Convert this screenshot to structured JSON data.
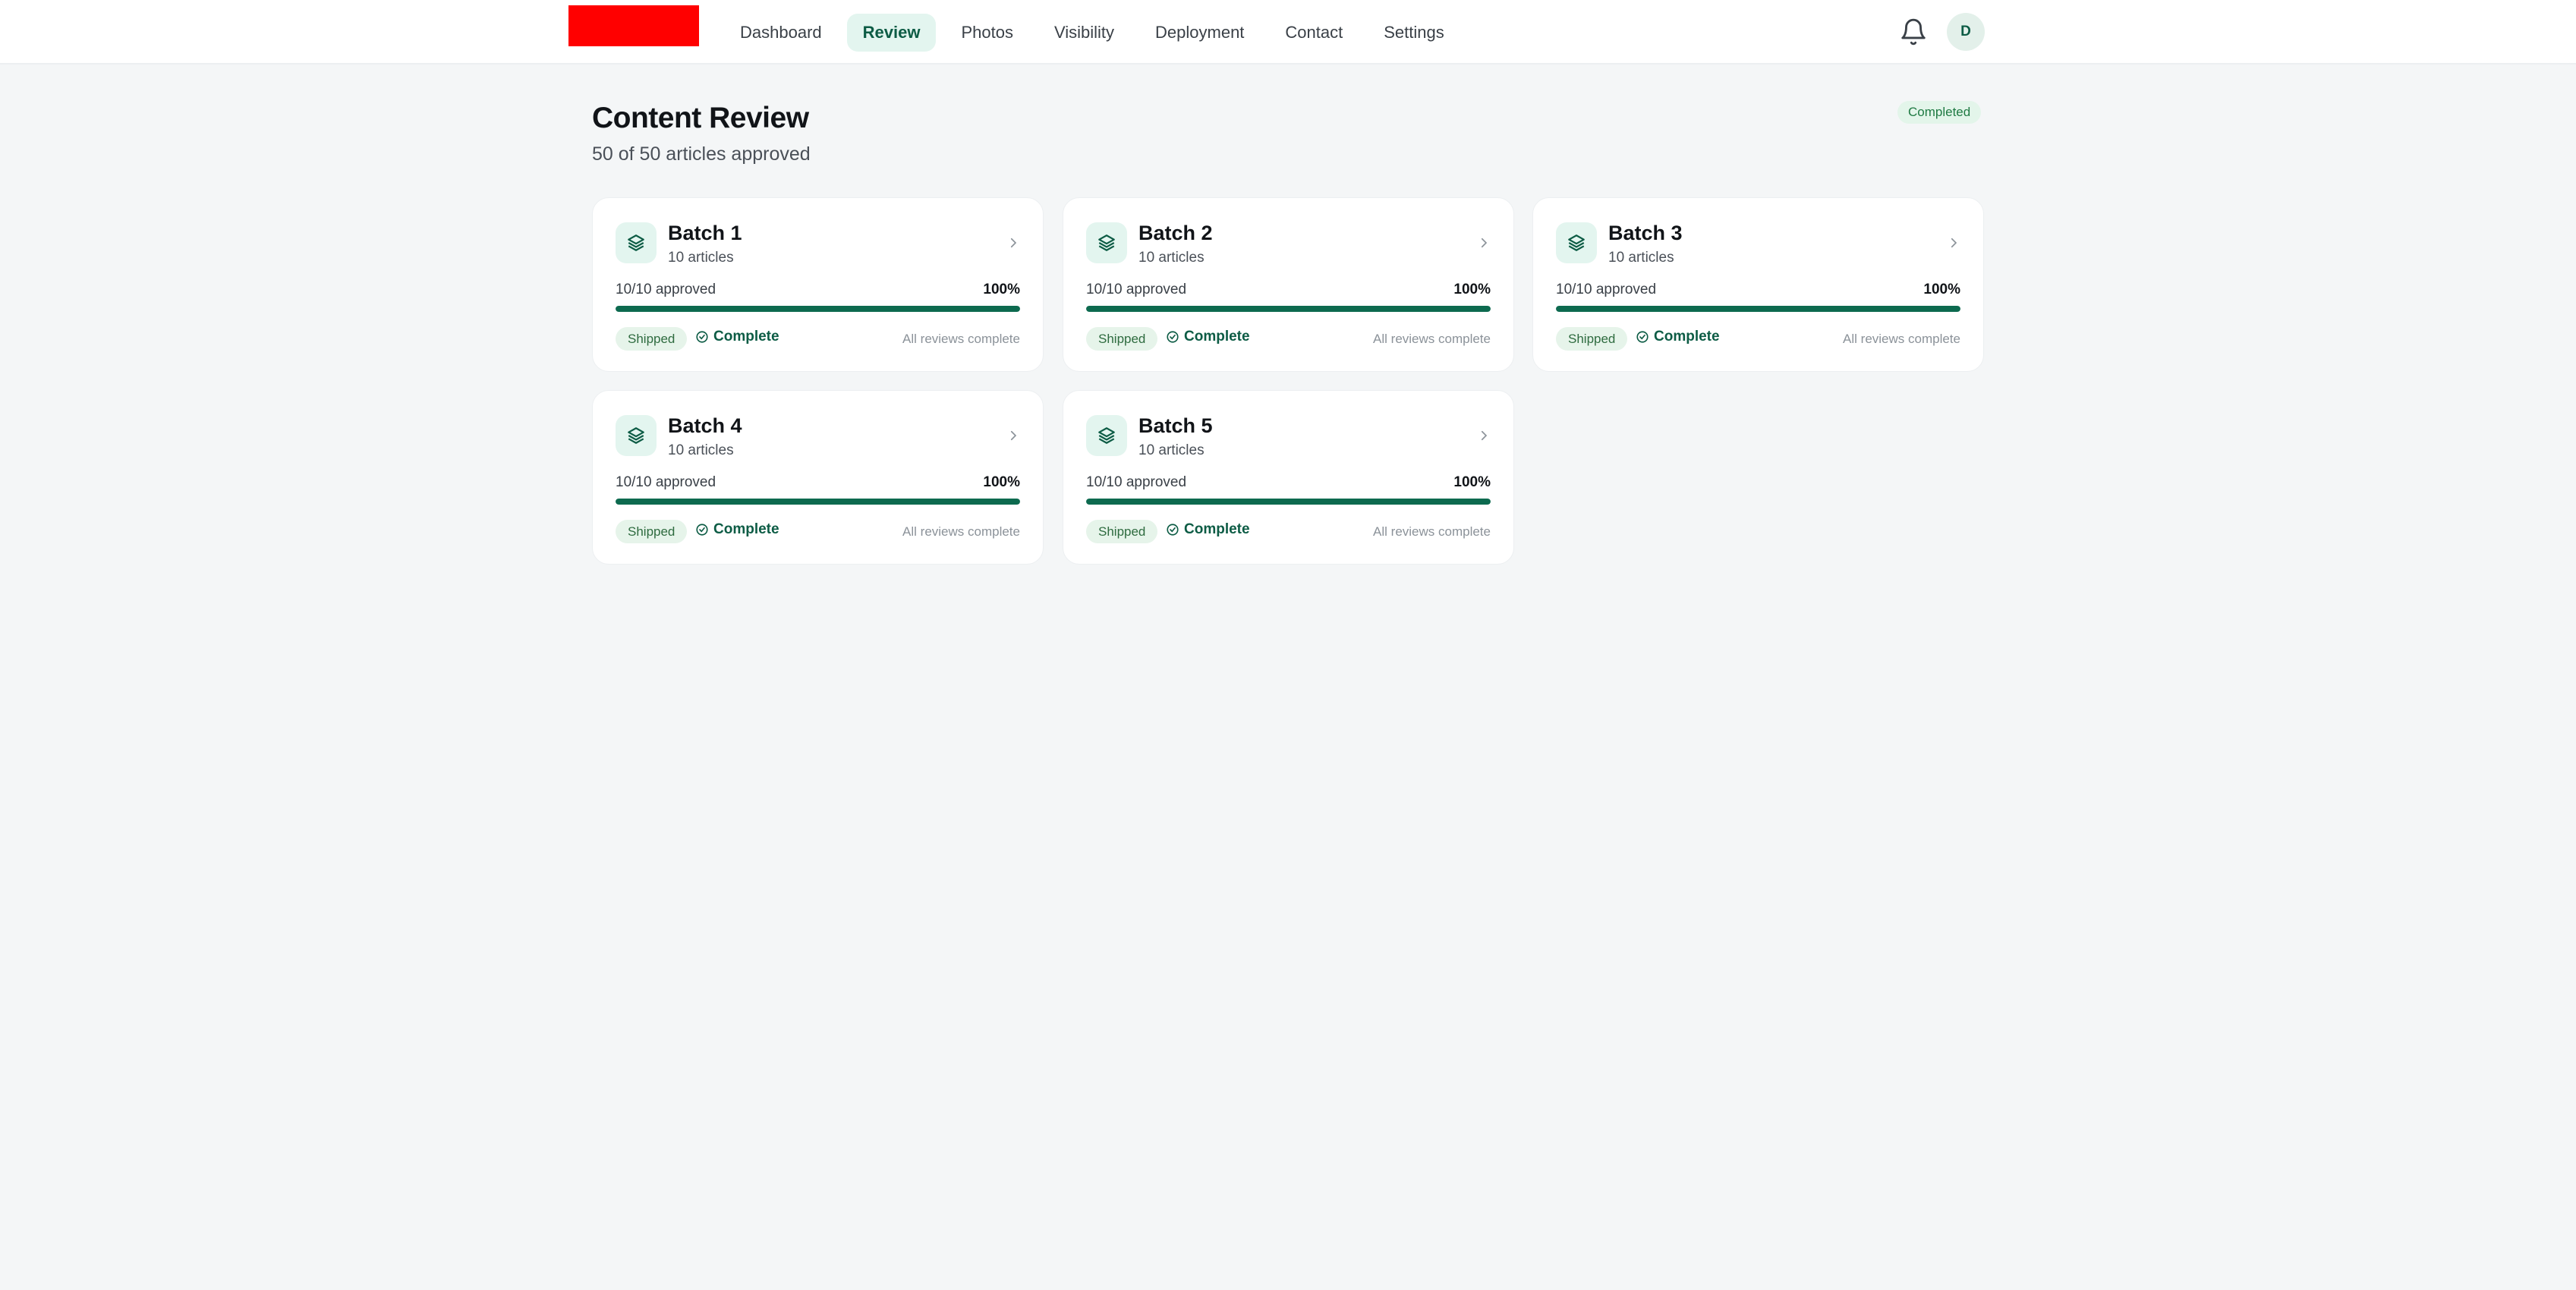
{
  "header": {
    "nav": [
      {
        "label": "Dashboard",
        "active": false
      },
      {
        "label": "Review",
        "active": true
      },
      {
        "label": "Photos",
        "active": false
      },
      {
        "label": "Visibility",
        "active": false
      },
      {
        "label": "Deployment",
        "active": false
      },
      {
        "label": "Contact",
        "active": false
      },
      {
        "label": "Settings",
        "active": false
      }
    ],
    "avatar_initial": "D",
    "icons": [
      "bell-icon"
    ]
  },
  "page": {
    "title": "Content Review",
    "subtitle": "50 of 50 articles approved",
    "status": "Completed"
  },
  "colors": {
    "accent": "#0d6a4f",
    "accent_bg": "#e3f5ef",
    "logo": "#ff0000",
    "success_text": "#1f7a43"
  },
  "batches": [
    {
      "name": "Batch 1",
      "count": "10 articles",
      "approved": "10/10 approved",
      "percent": "100%",
      "progress": 1.0,
      "tag": "Shipped",
      "state": "Complete",
      "note": "All reviews complete"
    },
    {
      "name": "Batch 2",
      "count": "10 articles",
      "approved": "10/10 approved",
      "percent": "100%",
      "progress": 1.0,
      "tag": "Shipped",
      "state": "Complete",
      "note": "All reviews complete"
    },
    {
      "name": "Batch 3",
      "count": "10 articles",
      "approved": "10/10 approved",
      "percent": "100%",
      "progress": 1.0,
      "tag": "Shipped",
      "state": "Complete",
      "note": "All reviews complete"
    },
    {
      "name": "Batch 4",
      "count": "10 articles",
      "approved": "10/10 approved",
      "percent": "100%",
      "progress": 1.0,
      "tag": "Shipped",
      "state": "Complete",
      "note": "All reviews complete"
    },
    {
      "name": "Batch 5",
      "count": "10 articles",
      "approved": "10/10 approved",
      "percent": "100%",
      "progress": 1.0,
      "tag": "Shipped",
      "state": "Complete",
      "note": "All reviews complete"
    }
  ]
}
